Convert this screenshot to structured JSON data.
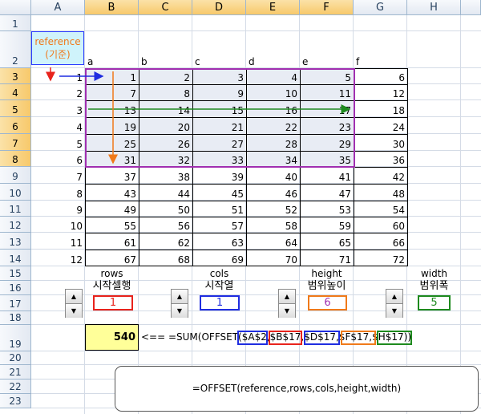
{
  "columns": [
    "A",
    "B",
    "C",
    "D",
    "E",
    "F",
    "G",
    "H"
  ],
  "rows": [
    "1",
    "2",
    "3",
    "4",
    "5",
    "6",
    "7",
    "8",
    "9",
    "10",
    "11",
    "12",
    "13",
    "14",
    "15",
    "16",
    "17",
    "18",
    "19",
    "20",
    "21",
    "22",
    "23"
  ],
  "reference_label": "reference",
  "reference_sub": "(기준)",
  "header_row": [
    "a",
    "b",
    "c",
    "d",
    "e",
    "f"
  ],
  "index_column": [
    "1",
    "2",
    "3",
    "4",
    "5",
    "6",
    "7",
    "8",
    "9",
    "10",
    "11",
    "12"
  ],
  "table": [
    [
      "1",
      "2",
      "3",
      "4",
      "5",
      "6"
    ],
    [
      "7",
      "8",
      "9",
      "10",
      "11",
      "12"
    ],
    [
      "13",
      "14",
      "15",
      "16",
      "17",
      "18"
    ],
    [
      "19",
      "20",
      "21",
      "22",
      "23",
      "24"
    ],
    [
      "25",
      "26",
      "27",
      "28",
      "29",
      "30"
    ],
    [
      "31",
      "32",
      "33",
      "34",
      "35",
      "36"
    ],
    [
      "37",
      "38",
      "39",
      "40",
      "41",
      "42"
    ],
    [
      "43",
      "44",
      "45",
      "46",
      "47",
      "48"
    ],
    [
      "49",
      "50",
      "51",
      "52",
      "53",
      "54"
    ],
    [
      "55",
      "56",
      "57",
      "58",
      "59",
      "60"
    ],
    [
      "61",
      "62",
      "63",
      "64",
      "65",
      "66"
    ],
    [
      "67",
      "68",
      "69",
      "70",
      "71",
      "72"
    ]
  ],
  "controls": {
    "rows": {
      "label_en": "rows",
      "label_ko": "시작셀행",
      "value": "1",
      "color": "#e8231c"
    },
    "cols": {
      "label_en": "cols",
      "label_ko": "시작열",
      "value": "1",
      "color": "#1f2de0"
    },
    "height": {
      "label_en": "height",
      "label_ko": "범위높이",
      "value": "6",
      "color": "#f07a1a"
    },
    "width": {
      "label_en": "width",
      "label_ko": "범위폭",
      "value": "5",
      "color": "#1e8a1e"
    }
  },
  "result": "540",
  "formula_text": "<== =SUM(OFFSET($A$2,$B$17,$D$17,$F$17,$H$17))",
  "note": "=OFFSET(reference,rows,cols,height,width)",
  "colors": {
    "purple": "#a12fb0",
    "blue": "#1f2de0",
    "green": "#1e8a1e",
    "orange": "#f07a1a",
    "red": "#e8231c",
    "yellow": "#ffff99",
    "cyan": "#cff3fb"
  }
}
